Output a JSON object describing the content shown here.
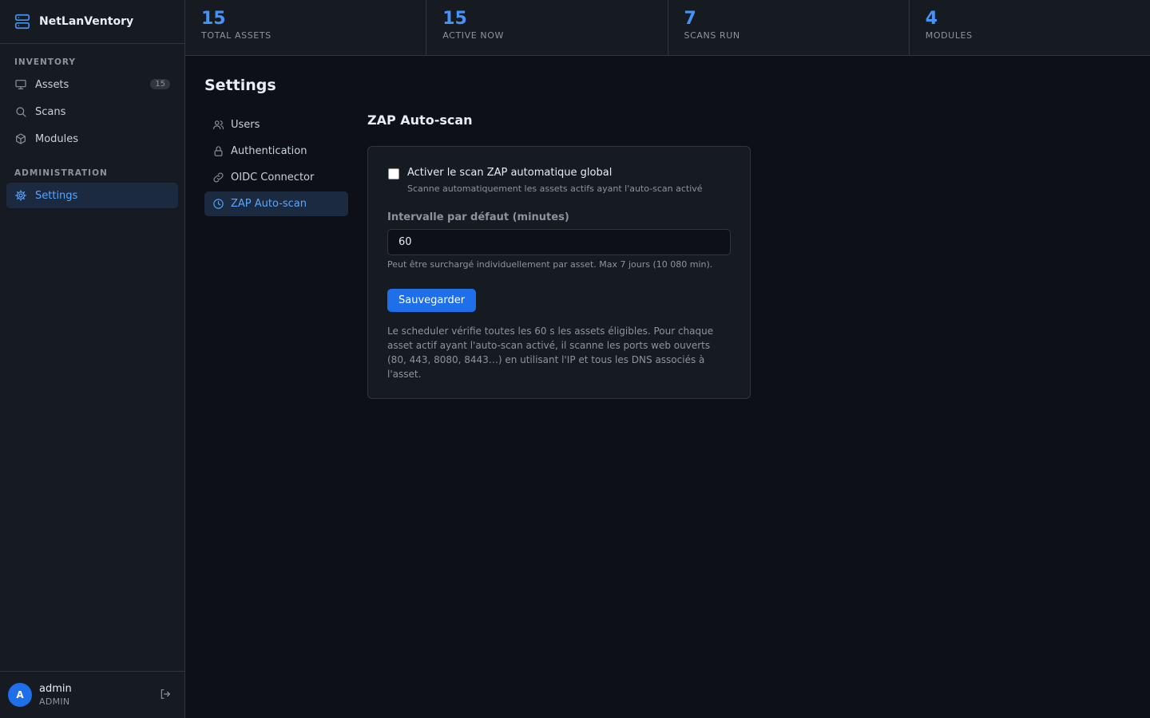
{
  "app": {
    "name": "NetLanVentory"
  },
  "sidebar": {
    "sections": [
      {
        "title": "INVENTORY"
      },
      {
        "title": "ADMINISTRATION"
      }
    ],
    "items": [
      {
        "label": "Assets",
        "badge": "15",
        "icon": "monitor-icon"
      },
      {
        "label": "Scans",
        "icon": "search-icon"
      },
      {
        "label": "Modules",
        "icon": "cube-icon"
      },
      {
        "label": "Settings",
        "icon": "gear-icon",
        "active": true
      }
    ]
  },
  "user": {
    "initial": "A",
    "name": "admin",
    "role": "ADMIN"
  },
  "stats": [
    {
      "value": "15",
      "label": "TOTAL ASSETS"
    },
    {
      "value": "15",
      "label": "ACTIVE NOW"
    },
    {
      "value": "7",
      "label": "SCANS RUN"
    },
    {
      "value": "4",
      "label": "MODULES"
    }
  ],
  "settings": {
    "title": "Settings",
    "nav": [
      {
        "label": "Users",
        "icon": "users-icon"
      },
      {
        "label": "Authentication",
        "icon": "lock-icon"
      },
      {
        "label": "OIDC Connector",
        "icon": "link-icon"
      },
      {
        "label": "ZAP Auto-scan",
        "icon": "clock-icon",
        "active": true
      }
    ]
  },
  "zap": {
    "title": "ZAP Auto-scan",
    "checkbox_label": "Activer le scan ZAP automatique global",
    "checkbox_checked": false,
    "checkbox_hint": "Scanne automatiquement les assets actifs ayant l'auto-scan activé",
    "interval_label": "Intervalle par défaut (minutes)",
    "interval_value": "60",
    "interval_hint": "Peut être surchargé individuellement par asset. Max 7 jours (10 080 min).",
    "save_label": "Sauvegarder",
    "info": "Le scheduler vérifie toutes les 60 s les assets éligibles. Pour chaque asset actif ayant l'auto-scan activé, il scanne les ports web ouverts (80, 443, 8080, 8443…) en utilisant l'IP et tous les DNS associés à l'asset."
  },
  "colors": {
    "accent": "#1f6feb",
    "accent_text": "#58a6ff",
    "background": "#0d1117",
    "panel": "#161b22"
  }
}
